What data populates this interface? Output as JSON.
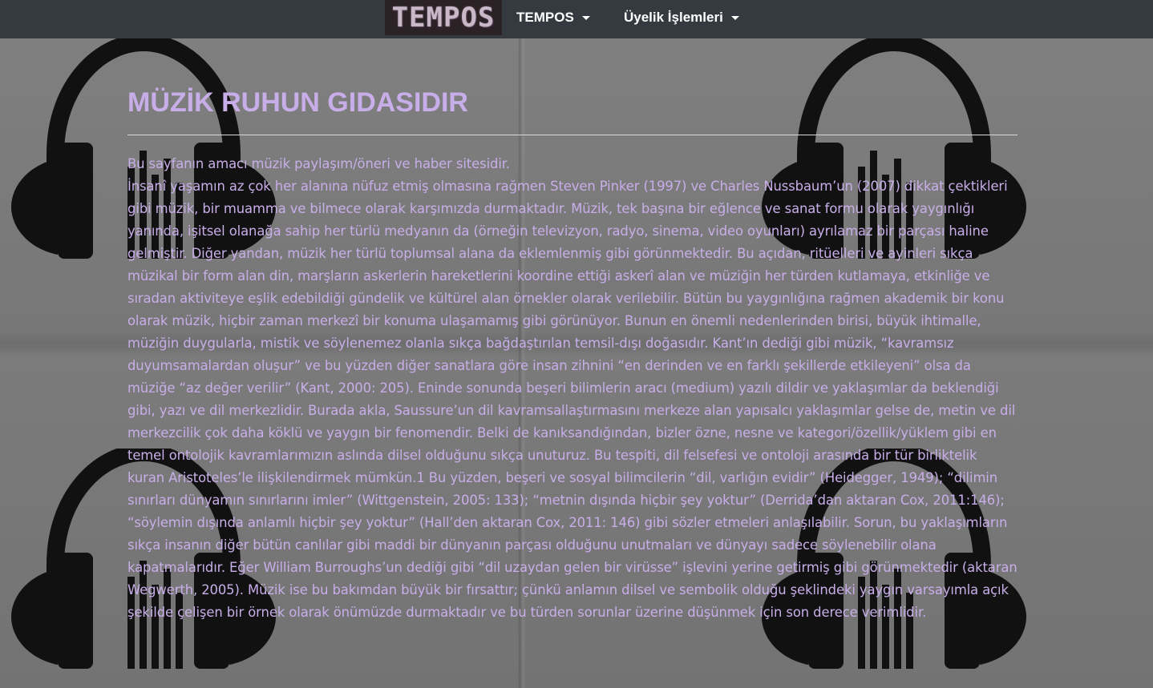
{
  "navbar": {
    "brand": "TEMPOS",
    "menu_tempos": "TEMPOS",
    "menu_membership": "Üyelik İşlemleri"
  },
  "page": {
    "title": "MÜZİK RUHUN GIDASIDIR",
    "intro": "Bu sayfanın amacı müzik paylaşım/öneri ve haber sitesidir.",
    "body": "İnsanî yaşamın az çok her alanına nüfuz etmiş olmasına rağmen Steven Pinker (1997) ve Charles Nussbaum’un (2007) dikkat çektikleri gibi müzik, bir muamma ve bilmece olarak karşımızda durmaktadır. Müzik, tek başına bir eğlence ve sanat formu olarak yaygınlığı yanında, işitsel olanağa sahip her türlü medyanın da (örneğin televizyon, radyo, sinema, video oyunları) ayrılamaz bir parçası haline gelmiştir. Diğer yandan, müzik her türlü toplumsal alana da eklemlenmiş gibi görünmektedir. Bu açıdan, ritüelleri ve ayinleri sıkça müzikal bir form alan din, marşların askerlerin hareketlerini koordine ettiği askerî alan ve müziğin her türden kutlamaya, etkinliğe ve sıradan aktiviteye eşlik edebildiği gündelik ve kültürel alan örnekler olarak verilebilir. Bütün bu yaygınlığına rağmen akademik bir konu olarak müzik, hiçbir zaman merkezî bir konuma ulaşamamış gibi görünüyor. Bunun en önemli nedenlerinden birisi, büyük ihtimalle, müziğin duygularla, mistik ve söylenemez olanla sıkça bağdaştırılan temsil-dışı doğasıdır. Kant’ın dediği gibi müzik, “kavramsız duyumsamalardan oluşur” ve bu yüzden diğer sanatlara göre insan zihnini “en derinden ve en farklı şekillerde etkileyeni” olsa da müziğe “az değer verilir” (Kant, 2000: 205). Eninde sonunda beşeri bilimlerin aracı (medium) yazılı dildir ve yaklaşımlar da beklendiği gibi, yazı ve dil merkezlidir. Burada akla, Saussure’un dil kavramsallaştırmasını merkeze alan yapısalcı yaklaşımlar gelse de, metin ve dil merkezcilik çok daha köklü ve yaygın bir fenomendir. Belki de kanıksandığından, bizler özne, nesne ve kategori/özellik/yüklem gibi en temel ontolojik kavramlarımızın aslında dilsel olduğunu sıkça unuturuz. Bu tespiti, dil felsefesi ve ontoloji arasında bir tür birliktelik kuran Aristoteles’le ilişkilendirmek mümkün.1 Bu yüzden, beşeri ve sosyal bilimcilerin “dil, varlığın evidir” (Heidegger, 1949); “dilimin sınırları dünyamın sınırlarını imler” (Wittgenstein, 2005: 133); “metnin dışında hiçbir şey yoktur” (Derrida’dan aktaran Cox, 2011:146); “söylemin dışında anlamlı hiçbir şey yoktur” (Hall’den aktaran Cox, 2011: 146) gibi sözler etmeleri anlaşılabilir. Sorun, bu yaklaşımların sıkça insanın diğer bütün canlılar gibi maddi bir dünyanın parçası olduğunu unutmaları ve dünyayı sadece söylenebilir olana kapatmalarıdır. Eğer William Burroughs’un dediği gibi “dil uzaydan gelen bir virüsse” işlevini yerine getirmiş gibi görünmektedir (aktaran Wegwerth, 2005). Müzik ise bu bakımdan büyük bir fırsattır; çünkü anlamın dilsel ve sembolik olduğu şeklindeki yaygın varsayımla açık şekilde çelişen bir örnek olarak önümüzde durmaktadır ve bu türden sorunlar üzerine düşünmek için son derece verimlidir."
  },
  "colors": {
    "navbar_bg": "#343a40",
    "accent_text": "#c8aee9",
    "background": "#7a7a7a",
    "icon": "#111111"
  },
  "icons": {
    "headphones": "headphones-icon"
  }
}
